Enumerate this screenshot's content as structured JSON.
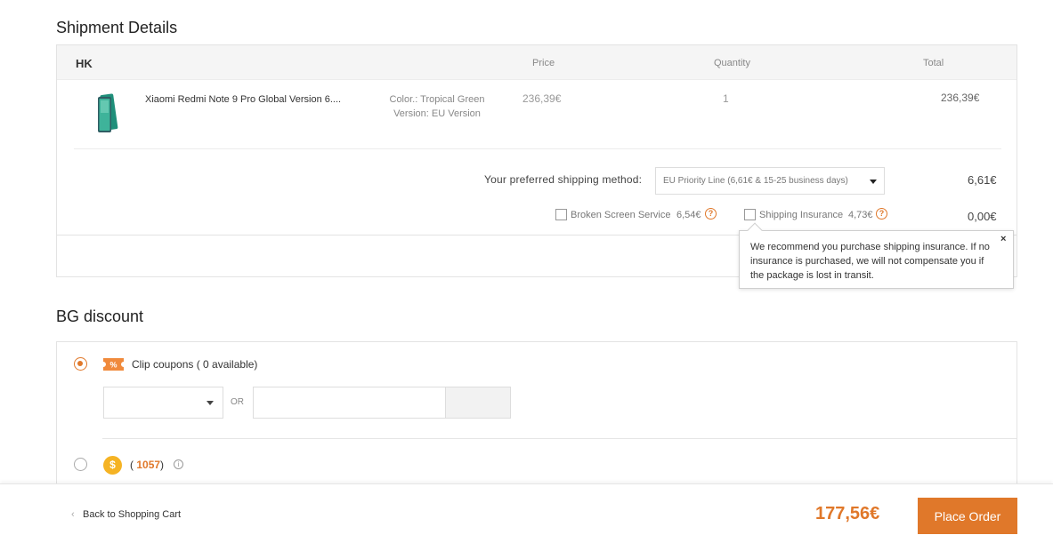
{
  "shipment": {
    "title": "Shipment Details",
    "warehouse": "HK",
    "columns": {
      "price": "Price",
      "quantity": "Quantity",
      "total": "Total"
    },
    "product": {
      "name": "Xiaomi Redmi Note 9 Pro Global Version 6....",
      "color": "Color.: Tropical Green",
      "version": "Version: EU Version",
      "price": "236,39€",
      "quantity": "1",
      "total": "236,39€"
    },
    "shipping_label": "Your preferred shipping method:",
    "shipping_method": "EU Priority Line (6,61€ & 15-25 business days)",
    "shipping_cost": "6,61€",
    "broken_screen_label": "Broken Screen Service",
    "broken_screen_price": "6,54€",
    "insurance_label": "Shipping Insurance",
    "insurance_price": "4,73€",
    "insurance_cost": "0,00€",
    "help_glyph": "?"
  },
  "tooltip": {
    "text": "We recommend you purchase shipping insurance. If no insurance is purchased, we will not compensate you if the package is lost in transit.",
    "close": "×"
  },
  "discount": {
    "title": "BG discount",
    "clip_label": "Clip coupons ( 0 available)",
    "or_label": "OR",
    "coin_glyph": "$",
    "points_value": "1057",
    "info_glyph": "i"
  },
  "footer": {
    "back_chevron": "‹",
    "back_label": "Back to Shopping Cart",
    "grand_total": "177,56€",
    "place_order": "Place Order"
  },
  "colors": {
    "accent": "#e0782a",
    "coin": "#f5b324"
  },
  "icons": [
    "phone-thumbnail",
    "caret-down-icon",
    "question-icon",
    "close-icon",
    "coupon-icon",
    "coin-icon",
    "info-icon",
    "chevron-left-icon"
  ]
}
